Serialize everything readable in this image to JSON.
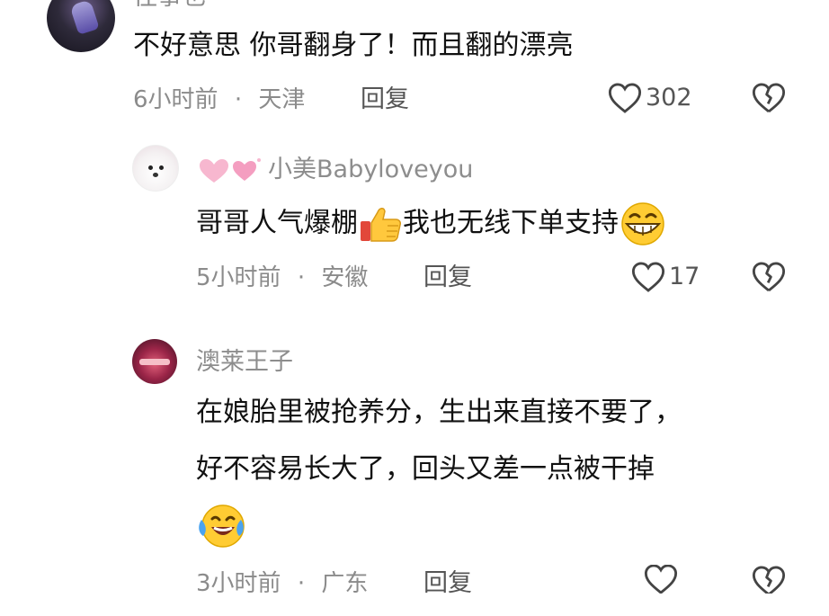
{
  "comments": [
    {
      "username": "往事也",
      "text": "不好意思 你哥翻身了！而且翻的漂亮",
      "time": "6小时前",
      "separator": "·",
      "location": "天津",
      "reply_label": "回复",
      "likes": "302"
    },
    {
      "username": "小美Babyloveyou",
      "text_part1": "哥哥人气爆棚",
      "text_part2": "我也无线下单支持",
      "time": "5小时前",
      "separator": "·",
      "location": "安徽",
      "reply_label": "回复",
      "likes": "17",
      "emojis": [
        "thumbs-up",
        "grinning-face"
      ]
    },
    {
      "username": "澳莱王子",
      "text_line1": "在娘胎里被抢养分，生出来直接不要了，",
      "text_line2": "好不容易长大了，回头又差一点被干掉",
      "time": "3小时前",
      "separator": "·",
      "location": "广东",
      "reply_label": "回复",
      "emojis": [
        "crying-laughing-face"
      ]
    }
  ],
  "colors": {
    "text": "#111111",
    "meta": "#8b8b8b",
    "icon": "#444444"
  }
}
